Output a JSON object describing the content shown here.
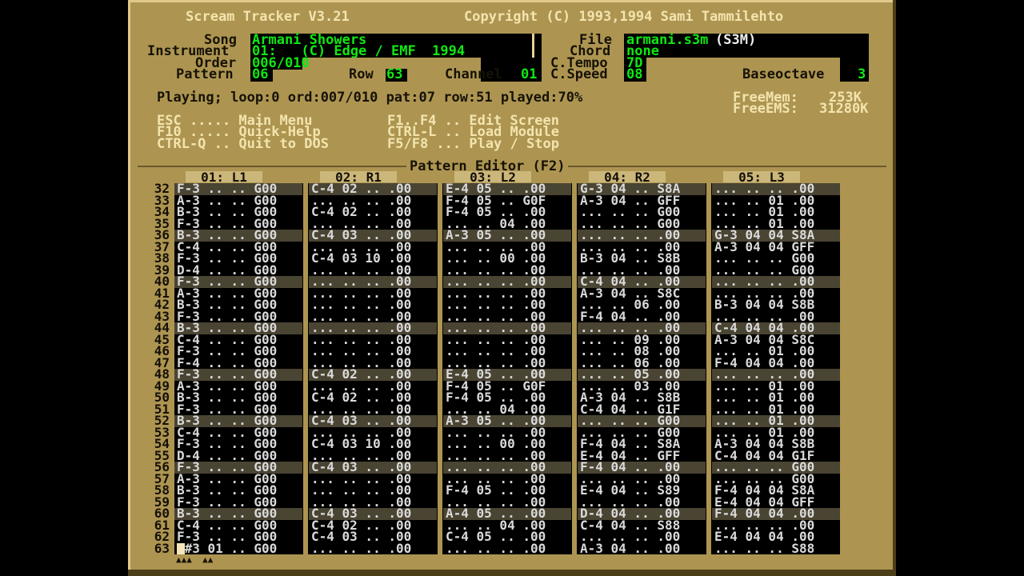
{
  "title_left": "Scream Tracker V3.21",
  "title_right": "Copyright (C) 1993,1994 Sami Tammilehto",
  "fields": {
    "song_label": "Song",
    "song": "Armani Showers",
    "instrument_label": "Instrument",
    "instrument": "01:   (C) Edge / EMF  1994",
    "order_label": "Order",
    "order": "006/010",
    "pattern_label": "Pattern",
    "pattern": "06",
    "row_label": "Row",
    "row": "63",
    "channel_label": "Channel",
    "channel": "01",
    "file_label": "File",
    "file": "armani.s3m",
    "file_type": "(S3M)",
    "chord_label": "Chord",
    "chord": "none",
    "ctempo_label": "C.Tempo",
    "ctempo": "7D",
    "cspeed_label": "C.Speed",
    "cspeed": "08",
    "baseoctave_label": "Baseoctave",
    "baseoctave": "3"
  },
  "status": "Playing; loop:0 ord:007/010 pat:07 row:51 played:70%",
  "memory": {
    "freemem_label": "FreeMem:",
    "freemem": "253K",
    "freeems_label": "FreeEMS:",
    "freeems": "31280K"
  },
  "help": {
    "col1": [
      "ESC ..... Main Menu",
      "F10 ..... Quick-Help",
      "CTRL-Q .. Quit to DOS"
    ],
    "col2": [
      "F1..F4 .. Edit Screen",
      "CTRL-L .. Load Module",
      "F5/F8 ... Play / Stop"
    ]
  },
  "editor_title": "Pattern Editor (F2)",
  "channels": [
    "01: L1",
    "02: R1",
    "03: L2",
    "04: R2",
    "05: L3"
  ],
  "row_numbers": [
    "32",
    "33",
    "34",
    "35",
    "36",
    "37",
    "38",
    "39",
    "40",
    "41",
    "42",
    "43",
    "44",
    "45",
    "46",
    "47",
    "48",
    "49",
    "50",
    "51",
    "52",
    "53",
    "54",
    "55",
    "56",
    "57",
    "58",
    "59",
    "60",
    "61",
    "62",
    "63"
  ],
  "pattern_rows": [
    [
      "F-3 .. .. G00",
      "C-4 02 .. .00",
      "E-4 05 .. .00",
      "G-3 04 .. S8A",
      "... .. .. .00"
    ],
    [
      "A-3 .. .. G00",
      "... .. .. .00",
      "F-4 05 .. G0F",
      "A-3 04 .. GFF",
      "... .. 01 .00"
    ],
    [
      "B-3 .. .. G00",
      "C-4 02 .. .00",
      "F-4 05 .. .00",
      "... .. .. G00",
      "... .. 01 .00"
    ],
    [
      "F-3 .. .. G00",
      "... .. .. .00",
      "... .. 04 .00",
      "... .. .. G00",
      "... .. 01 .00"
    ],
    [
      "B-3 .. .. G00",
      "C-4 03 .. .00",
      "A-3 05 .. .00",
      "... .. .. .00",
      "G-3 04 04 S8A"
    ],
    [
      "C-4 .. .. G00",
      "... .. .. .00",
      "... .. .. .00",
      "... .. .. .00",
      "A-3 04 04 GFF"
    ],
    [
      "F-3 .. .. G00",
      "C-4 03 10 .00",
      "... .. 00 .00",
      "B-3 04 .. S8B",
      "... .. .. G00"
    ],
    [
      "D-4 .. .. G00",
      "... .. .. .00",
      "... .. .. .00",
      "... .. .. .00",
      "... .. .. G00"
    ],
    [
      "F-3 .. .. G00",
      "... .. .. .00",
      "... .. .. .00",
      "C-4 04 .. .00",
      "... .. .. .00"
    ],
    [
      "A-3 .. .. G00",
      "... .. .. .00",
      "... .. .. .00",
      "A-3 04 .. S8C",
      "... .. .. .00"
    ],
    [
      "B-3 .. .. G00",
      "... .. .. .00",
      "... .. .. .00",
      "... .. 06 .00",
      "B-3 04 04 S8B"
    ],
    [
      "F-3 .. .. G00",
      "... .. .. .00",
      "... .. .. .00",
      "F-4 04 .. .00",
      "... .. .. .00"
    ],
    [
      "B-3 .. .. G00",
      "... .. .. .00",
      "... .. .. .00",
      "... .. .. .00",
      "C-4 04 04 .00"
    ],
    [
      "C-4 .. .. G00",
      "... .. .. .00",
      "... .. .. .00",
      "... .. 09 .00",
      "A-3 04 04 S8C"
    ],
    [
      "F-3 .. .. G00",
      "... .. .. .00",
      "... .. .. .00",
      "... .. 08 .00",
      "... .. 01 .00"
    ],
    [
      "F-4 .. .. G00",
      "... .. .. .00",
      "... .. .. .00",
      "... .. 06 .00",
      "F-4 04 04 .00"
    ],
    [
      "F-3 .. .. G00",
      "C-4 02 .. .00",
      "E-4 05 .. .00",
      "... .. 05 .00",
      "... .. .. .00"
    ],
    [
      "A-3 .. .. G00",
      "... .. .. .00",
      "F-4 05 .. G0F",
      "... .. 03 .00",
      "... .. 01 .00"
    ],
    [
      "B-3 .. .. G00",
      "C-4 02 .. .00",
      "F-4 05 .. .00",
      "A-3 04 .. S8B",
      "... .. 01 .00"
    ],
    [
      "F-3 .. .. G00",
      "... .. .. .00",
      "... .. 04 .00",
      "C-4 04 .. G1F",
      "... .. 01 .00"
    ],
    [
      "B-3 .. .. G00",
      "C-4 03 .. .00",
      "A-3 05 .. .00",
      "... .. .. G00",
      "... .. 01 .00"
    ],
    [
      "C-4 .. .. G00",
      "... .. .. .00",
      "... .. .. .00",
      "... .. .. G00",
      "... .. 01 .00"
    ],
    [
      "F-3 .. .. G00",
      "C-4 03 10 .00",
      "... .. 00 .00",
      "F-4 04 .. S8A",
      "A-3 04 04 S8B"
    ],
    [
      "D-4 .. .. G00",
      "... .. .. .00",
      "... .. .. .00",
      "E-4 04 .. GFF",
      "C-4 04 04 G1F"
    ],
    [
      "F-3 .. .. G00",
      "C-4 03 .. .00",
      "... .. .. .00",
      "F-4 04 .. .00",
      "... .. .. G00"
    ],
    [
      "A-3 .. .. G00",
      "... .. .. .00",
      "... .. .. .00",
      "... .. .. .00",
      "... .. .. G00"
    ],
    [
      "B-3 .. .. G00",
      "... .. .. .00",
      "F-4 05 .. .00",
      "E-4 04 .. S89",
      "F-4 04 04 S8A"
    ],
    [
      "F-3 .. .. G00",
      "... .. .. .00",
      "... .. .. .00",
      "... .. .. .00",
      "E-4 04 04 GFF"
    ],
    [
      "B-3 .. .. G00",
      "C-4 03 .. .00",
      "A-4 05 .. .00",
      "D-4 04 .. .00",
      "F-4 04 04 .00"
    ],
    [
      "C-4 .. .. G00",
      "C-4 02 .. .00",
      "... .. 04 .00",
      "C-4 04 .. S88",
      "... .. .. .00"
    ],
    [
      "F-3 .. .. G00",
      "C-4 03 .. .00",
      "C-4 05 .. .00",
      "... .. .. .00",
      "E-4 04 04 .00"
    ],
    [
      "E#3 01 .. G00",
      "... .. .. .00",
      "... .. .. .00",
      "A-3 04 .. .00",
      "... .. .. S88"
    ]
  ],
  "highlight_row_indices": [
    0,
    4,
    8,
    12,
    16,
    20,
    24,
    28
  ],
  "cursor_marks": "▲▲▲  ▲▲"
}
